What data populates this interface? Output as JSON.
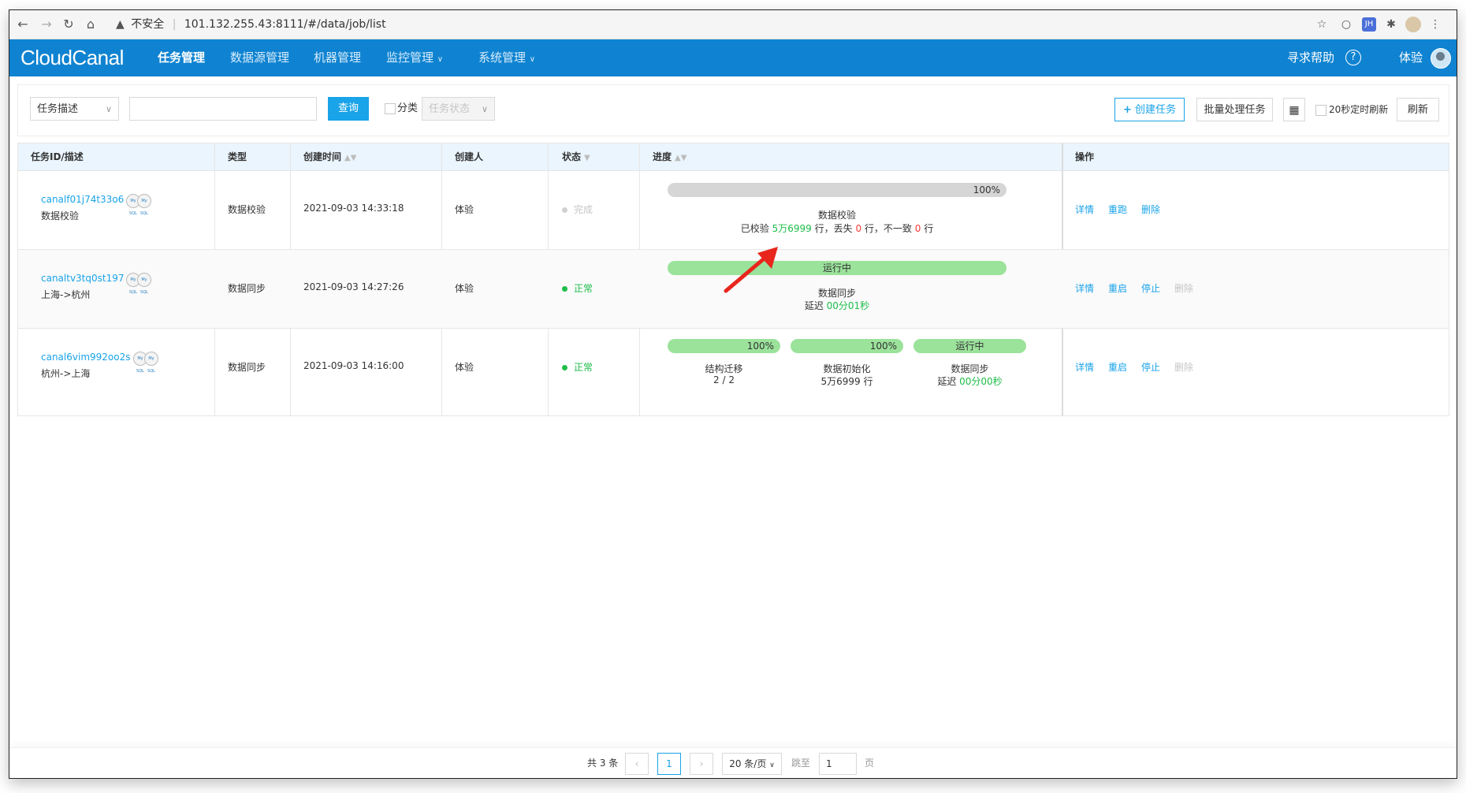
{
  "browser": {
    "security_label": "不安全",
    "url": "101.132.255.43:8111/#/data/job/list",
    "ext_jh": "JH"
  },
  "header": {
    "logo": "CloudCanal",
    "nav": [
      "任务管理",
      "数据源管理",
      "机器管理",
      "监控管理",
      "系统管理"
    ],
    "help_label": "寻求帮助",
    "user_label": "体验"
  },
  "filters": {
    "field_select": "任务描述",
    "search_button": "查询",
    "category_label": "分类",
    "status_select_placeholder": "任务状态",
    "create_button": "创建任务",
    "batch_button": "批量处理任务",
    "auto_refresh_label": "20秒定时刷新",
    "refresh_button": "刷新"
  },
  "table": {
    "columns": [
      "任务ID/描述",
      "类型",
      "创建时间",
      "创建人",
      "状态",
      "进度",
      "操作"
    ],
    "rows": [
      {
        "id": "canalf01j74t33o6",
        "desc": "数据校验",
        "type": "数据校验",
        "created": "2021-09-03 14:33:18",
        "creator": "体验",
        "status": "完成",
        "progress": {
          "bar_text": "100%",
          "title": "数据校验",
          "detail_prefix": "已校验 ",
          "checked": "5万6999",
          "detail_mid1": " 行，丢失 ",
          "lost": "0",
          "detail_mid2": " 行，不一致 ",
          "inconsistent": "0",
          "detail_suffix": " 行"
        },
        "actions": [
          "详情",
          "重跑",
          "删除"
        ]
      },
      {
        "id": "canaltv3tq0st197",
        "desc": "上海->杭州",
        "type": "数据同步",
        "created": "2021-09-03 14:27:26",
        "creator": "体验",
        "status": "正常",
        "progress": {
          "bar_text": "运行中",
          "title": "数据同步",
          "delay_prefix": "延迟 ",
          "delay": "00分01秒"
        },
        "actions": [
          "详情",
          "重启",
          "停止",
          "删除"
        ]
      },
      {
        "id": "canal6vim992oo2s",
        "desc": "杭州->上海",
        "type": "数据同步",
        "created": "2021-09-03 14:16:00",
        "creator": "体验",
        "status": "正常",
        "stages": [
          {
            "bar": "100%",
            "name": "结构迁移",
            "detail": "2 / 2"
          },
          {
            "bar": "100%",
            "name": "数据初始化",
            "detail": "5万6999 行"
          },
          {
            "bar": "运行中",
            "name": "数据同步",
            "detail_prefix": "延迟 ",
            "detail": "00分00秒"
          }
        ],
        "actions": [
          "详情",
          "重启",
          "停止",
          "删除"
        ]
      }
    ],
    "db_icon_label": "My SQL"
  },
  "pagination": {
    "total": "共 3 条",
    "current_page": "1",
    "page_size": "20 条/页",
    "goto_label": "跳至",
    "goto_value": "1",
    "page_suffix": "页"
  },
  "colors": {
    "brand": "#0f83d1",
    "primary": "#19a3e8",
    "success": "#1ebd4a",
    "danger": "#f53a3a",
    "annotation_arrow": "#e8261c"
  }
}
